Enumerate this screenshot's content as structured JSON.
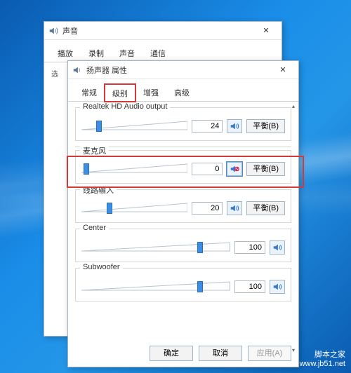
{
  "back_window": {
    "title": "声音",
    "icon": "speaker-icon",
    "tabs": [
      "播放",
      "录制",
      "声音",
      "通信"
    ]
  },
  "front_window": {
    "title": "扬声器 属性",
    "icon": "speaker-icon",
    "tabs": [
      {
        "label": "常规"
      },
      {
        "label": "级别",
        "active": true
      },
      {
        "label": "增强"
      },
      {
        "label": "高级"
      }
    ],
    "channels": [
      {
        "name": "Realtek HD Audio output",
        "value": "24",
        "pos": 14,
        "muted": false,
        "balance": "平衡(B)"
      },
      {
        "name": "麦克风",
        "value": "0",
        "pos": 2,
        "muted": true,
        "balance": "平衡(B)",
        "highlight": true
      },
      {
        "name": "线路输入",
        "value": "20",
        "pos": 24,
        "muted": false,
        "balance": "平衡(B)"
      },
      {
        "name": "Center",
        "value": "100",
        "pos": 78,
        "muted": false,
        "nobal": true
      },
      {
        "name": "Subwoofer",
        "value": "100",
        "pos": 78,
        "muted": false,
        "nobal": true
      }
    ],
    "buttons": {
      "ok": "确定",
      "cancel": "取消",
      "apply": "应用(A)"
    }
  },
  "watermark": {
    "l1": "脚本之家",
    "l2": "www.jb51.net"
  }
}
